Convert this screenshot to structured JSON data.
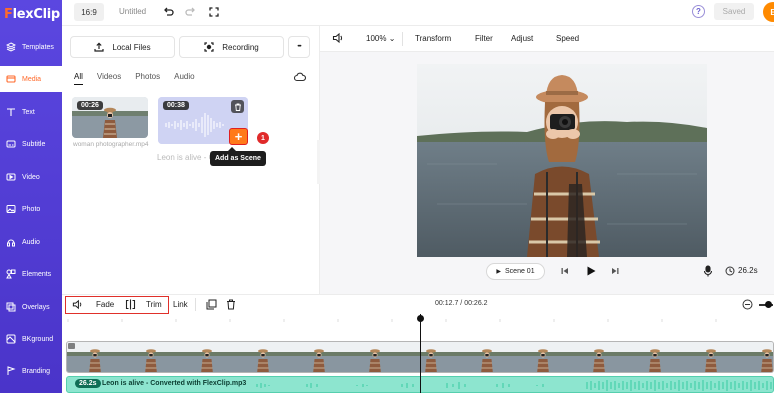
{
  "app": {
    "logo": "FlexClip"
  },
  "topbar": {
    "ratio": "16:9",
    "project_title": "Untitled",
    "help": "?",
    "saved_label": "Saved",
    "export_initial": "E"
  },
  "sidebar": {
    "items": [
      {
        "label": "Templates",
        "icon": "templates-icon"
      },
      {
        "label": "Media",
        "icon": "media-icon",
        "active": true
      },
      {
        "label": "Text",
        "icon": "text-icon"
      },
      {
        "label": "Subtitle",
        "icon": "subtitle-icon"
      },
      {
        "label": "Video",
        "icon": "video-icon"
      },
      {
        "label": "Photo",
        "icon": "photo-icon"
      },
      {
        "label": "Audio",
        "icon": "audio-icon"
      },
      {
        "label": "Elements",
        "icon": "elements-icon"
      },
      {
        "label": "Overlays",
        "icon": "overlays-icon"
      },
      {
        "label": "BKground",
        "icon": "background-icon"
      },
      {
        "label": "Branding",
        "icon": "branding-icon"
      }
    ]
  },
  "media": {
    "local_files_label": "Local Files",
    "recording_label": "Recording",
    "more_label": "•••",
    "tabs": [
      "All",
      "Videos",
      "Photos",
      "Audio"
    ],
    "items": [
      {
        "duration": "00:26",
        "name": "woman photographer.mp4"
      },
      {
        "duration": "00:38",
        "name": "Leon is alive - C"
      }
    ],
    "add_scene_tooltip": "Add as Scene",
    "step_badge": "1"
  },
  "preview": {
    "zoom": "100%",
    "tools": [
      "Transform",
      "Filter",
      "Adjust",
      "Speed"
    ],
    "scene_label": "Scene  01",
    "total_duration": "26.2s"
  },
  "timeline_toolbar": {
    "fade_label": "Fade",
    "trim_label": "Trim",
    "link_label": "Link",
    "time_readout": "00:12.7 / 00:26.2"
  },
  "timeline": {
    "audio_duration": "26.2s",
    "audio_title": "Leon is alive - Converted with FlexClip.mp3"
  },
  "colors": {
    "sidebar": "#5b47e0",
    "accent": "#ff7a1a",
    "highlight_box": "#e0302a",
    "audio_track": "#8de5cf"
  }
}
